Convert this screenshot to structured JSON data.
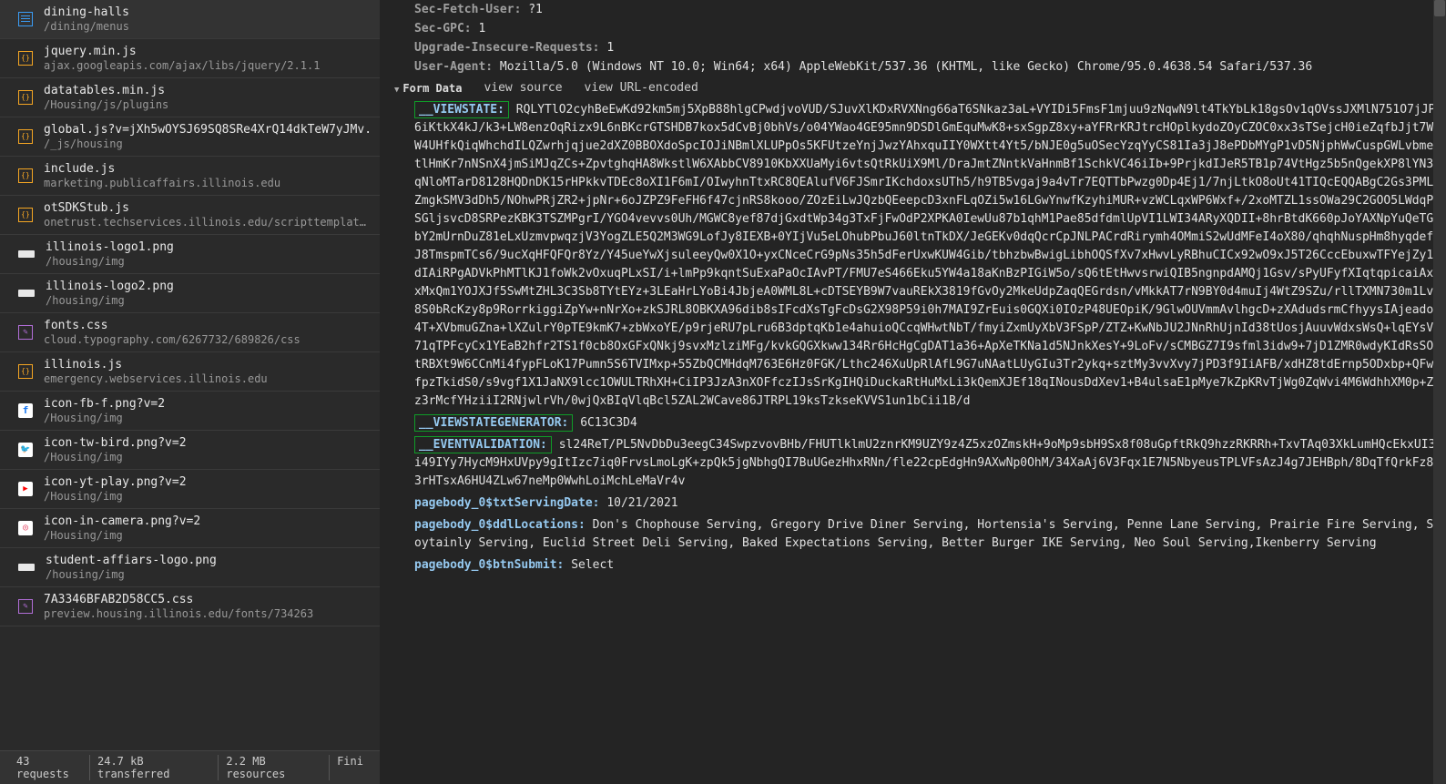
{
  "sidebar": {
    "files": [
      {
        "name": "dining-halls",
        "path": "/dining/menus",
        "icon": "doc",
        "selected": true
      },
      {
        "name": "jquery.min.js",
        "path": "ajax.googleapis.com/ajax/libs/jquery/2.1.1",
        "icon": "js"
      },
      {
        "name": "datatables.min.js",
        "path": "/Housing/js/plugins",
        "icon": "js"
      },
      {
        "name": "global.js?v=jXh5wOYSJ69SQ8SRe4XrQ14dkTeW7yJMv.",
        "path": "/_js/housing",
        "icon": "js"
      },
      {
        "name": "include.js",
        "path": "marketing.publicaffairs.illinois.edu",
        "icon": "js"
      },
      {
        "name": "otSDKStub.js",
        "path": "onetrust.techservices.illinois.edu/scripttemplates",
        "icon": "js"
      },
      {
        "name": "illinois-logo1.png",
        "path": "/housing/img",
        "icon": "img"
      },
      {
        "name": "illinois-logo2.png",
        "path": "/housing/img",
        "icon": "img"
      },
      {
        "name": "fonts.css",
        "path": "cloud.typography.com/6267732/689826/css",
        "icon": "css"
      },
      {
        "name": "illinois.js",
        "path": "emergency.webservices.illinois.edu",
        "icon": "js"
      },
      {
        "name": "icon-fb-f.png?v=2",
        "path": "/Housing/img",
        "icon": "fb"
      },
      {
        "name": "icon-tw-bird.png?v=2",
        "path": "/Housing/img",
        "icon": "tw"
      },
      {
        "name": "icon-yt-play.png?v=2",
        "path": "/Housing/img",
        "icon": "yt"
      },
      {
        "name": "icon-in-camera.png?v=2",
        "path": "/Housing/img",
        "icon": "ig"
      },
      {
        "name": "student-affiars-logo.png",
        "path": "/housing/img",
        "icon": "img"
      },
      {
        "name": "7A3346BFAB2D58CC5.css",
        "path": "preview.housing.illinois.edu/fonts/734263",
        "icon": "css"
      }
    ]
  },
  "status": {
    "requests": "43 requests",
    "transferred": "24.7 kB transferred",
    "resources": "2.2 MB resources",
    "finish": "Fini"
  },
  "headers_top": [
    {
      "k": "Sec-Fetch-User:",
      "v": " ?1"
    },
    {
      "k": "Sec-GPC:",
      "v": " 1"
    },
    {
      "k": "Upgrade-Insecure-Requests:",
      "v": " 1"
    },
    {
      "k": "User-Agent:",
      "v": " Mozilla/5.0 (Windows NT 10.0; Win64; x64) AppleWebKit/537.36 (KHTML, like Gecko) Chrome/95.0.4638.54 Safari/537.36"
    }
  ],
  "form_section": {
    "title": "Form Data",
    "view_source": "view source",
    "view_url": "view URL-encoded"
  },
  "form_data": [
    {
      "key": "__VIEWSTATE:",
      "boxed": true,
      "val": " RQLYTlO2cyhBeEwKd92km5mj5XpB88hlgCPwdjvoVUD/SJuvXlKDxRVXNng66aT6SNkaz3aL+VYIDi5FmsF1mjuu9zNqwN9lt4TkYbLk18gsOv1qOVssJXMlN751O7jJP6iKtkX4kJ/k3+LW8enzOqRizx9L6nBKcrGTSHDB7kox5dCvBj0bhVs/o04YWao4GE95mn9DSDlGmEquMwK8+sxSgpZ8xy+aYFRrKRJtrcHOplkydoZOyCZOC0xx3sTSejcH0ieZqfbJjt7WW4UHfkQiqWhchdILQZwrhjqjue2dXZ0BBOXdoSpcIOJiNBmlXLUPpOs5KFUtzeYnjJwzYAhxquIIY0WXtt4Yt5/bNJE0g5uOSecYzqYyCS81Ia3jJ8ePDbMYgP1vD5NjphWwCuspGWLvbmetlHmKr7nNSnX4jmSiMJqZCs+ZpvtghqHA8WkstlW6XAbbCV8910KbXXUaMyi6vtsQtRkUiX9Ml/DraJmtZNntkVaHnmBf1SchkVC46iIb+9PrjkdIJeR5TB1p74VtHgz5b5nQgekXP8lYN3qNloMTarD8128HQDnDK15rHPkkvTDEc8oXI1F6mI/OIwyhnTtxRC8QEAlufV6FJSmrIKchdoxsUTh5/h9TB5vgaj9a4vTr7EQTTbPwzg0Dp4Ej1/7njLtkO8oUt41TIQcEQQABgC2Gs3PMLZmgkSMV3dDh5/NOhwPRjZR2+jpNr+6oJZPZ9FeFH6f47cjnRS8kooo/ZOzEiLwJQzbQEeepcD3xnFLqOZi5w16LGwYnwfKzyhiMUR+vzWCLqxWP6Wxf+/2xoMTZL1ssOWa29C2GOO5LWdqPSGljsvcD8SRPezKBK3TSZMPgrI/YGO4vevvs0Uh/MGWC8yef87djGxdtWp34g3TxFjFwOdP2XPKA0IewUu87b1qhM1Pae85dfdmlUpVI1LWI34ARyXQDII+8hrBtdK660pJoYAXNpYuQeTGbY2mUrnDuZ81eLxUzmvpwqzjV3YogZLE5Q2M3WG9LofJy8IEXB+0YIjVu5eLOhubPbuJ60ltnTkDX/JeGEKv0dqQcrCpJNLPACrdRirymh4OMmiS2wUdMFeI4oX80/qhqhNuspHm8hyqdefJ8TmspmTCs6/9ucXqHFQFQr8Yz/Y45ueYwXjsuleeyQw0X1O+yxCNceCrG9pNs35h5dFerUxwKUW4Gib/tbhzbwBwigLibhOQSfXv7xHwvLyRBhuCICx92wO9xJ5T26CccEbuxwTFYejZy1dIAiRPgADVkPhMTlKJ1foWk2vOxuqPLxSI/i+lmPp9kqntSuExaPaOcIAvPT/FMU7eS466Eku5YW4a18aKnBzPIGiW5o/sQ6tEtHwvsrwiQIB5ngnpdAMQj1Gsv/sPyUFyfXIqtqpicaiAxxMxQm1YOJXJf5SwMtZHL3C3Sb8TYtEYz+3LEaHrLYoBi4JbjeA0WML8L+cDTSEYB9W7vauREkX3819fGvOy2MkeUdpZaqQEGrdsn/vMkkAT7rN9BY0d4muIj4WtZ9SZu/rllTXMN730m1Lv8S0bRcKzy8p9RorrkiggiZpYw+nNrXo+zkSJRL8OBKXA96dib8sIFcdXsTgFcDsG2X98P59i0h7MAI9ZrEuis0GQXi0IOzP48UEOpiK/9GlwOUVmmAvlhgcD+zXAdudsrmCfhyysIAjeado4T+XVbmuGZna+lXZulrY0pTE9kmK7+zbWxoYE/p9rjeRU7pLru6B3dptqKb1e4ahuioQCcqWHwtNbT/fmyiZxmUyXbV3FSpP/ZTZ+KwNbJU2JNnRhUjnId38tUosjAuuvWdxsWsQ+lqEYsV71qTPFcyCx1YEaB2hfr2TS1f0cb8OxGFxQNkj9svxMzlziMFg/kvkGQGXkww134Rr6HcHgCgDAT1a36+ApXeTKNa1d5NJnkXesY+9LoFv/sCMBGZ7I9sfml3idw9+7jD1ZMR0wdyKIdRsSOtRBXt9W6CCnMi4fypFLoK17Pumn5S6TVIMxp+55ZbQCMHdqM763E6Hz0FGK/Lthc246XuUpRlAfL9G7uNAatLUyGIu3Tr2ykq+sztMy3vvXvy7jPD3f9IiAFB/xdHZ8tdErnp5ODxbp+QFwfpzTkidS0/s9vgf1X1JaNX9lcc1OWULTRhXH+CiIP3JzA3nXOFfczIJsSrKgIHQiDuckaRtHuMxLi3kQemXJEf18qINousDdXev1+B4ulsaE1pMye7kZpKRvTjWg0ZqWvi4M6WdhhXM0p+Zz3rMcfYHziiI2RNjwlrVh/0wjQxBIqVlqBcl5ZAL2WCave86JTRPL19ksTzkseKVVS1un1bCii1B/d"
    },
    {
      "key": "__VIEWSTATEGENERATOR:",
      "boxed": true,
      "val": " 6C13C3D4"
    },
    {
      "key": "__EVENTVALIDATION:",
      "boxed": true,
      "val": " sl24ReT/PL5NvDbDu3eegC34SwpzvovBHb/FHUTlklmU2znrKM9UZY9z4Z5xzOZmskH+9oMp9sbH9Sx8f08uGpftRkQ9hzzRKRRh+TxvTAq03XkLumHQcEkxUI3i49IYy7HycM9HxUVpy9gItIzc7iq0FrvsLmoLgK+zpQk5jgNbhgQI7BuUGezHhxRNn/fle22cpEdgHn9AXwNp0OhM/34XaAj6V3Fqx1E7N5NbyeusTPLVFsAzJ4g7JEHBph/8DqTfQrkFz83rHTsxA6HU4ZLw67neMp0WwhLoiMchLeMaVr4v"
    },
    {
      "key": "pagebody_0$txtServingDate:",
      "boxed": false,
      "val": " 10/21/2021"
    },
    {
      "key": "pagebody_0$ddlLocations:",
      "boxed": false,
      "val": " Don's Chophouse Serving, Gregory Drive Diner Serving, Hortensia's Serving, Penne Lane Serving, Prairie Fire Serving, Soytainly Serving, Euclid Street Deli Serving, Baked Expectations Serving, Better Burger IKE Serving, Neo Soul Serving,Ikenberry Serving"
    },
    {
      "key": "pagebody_0$btnSubmit:",
      "boxed": false,
      "val": " Select"
    }
  ]
}
